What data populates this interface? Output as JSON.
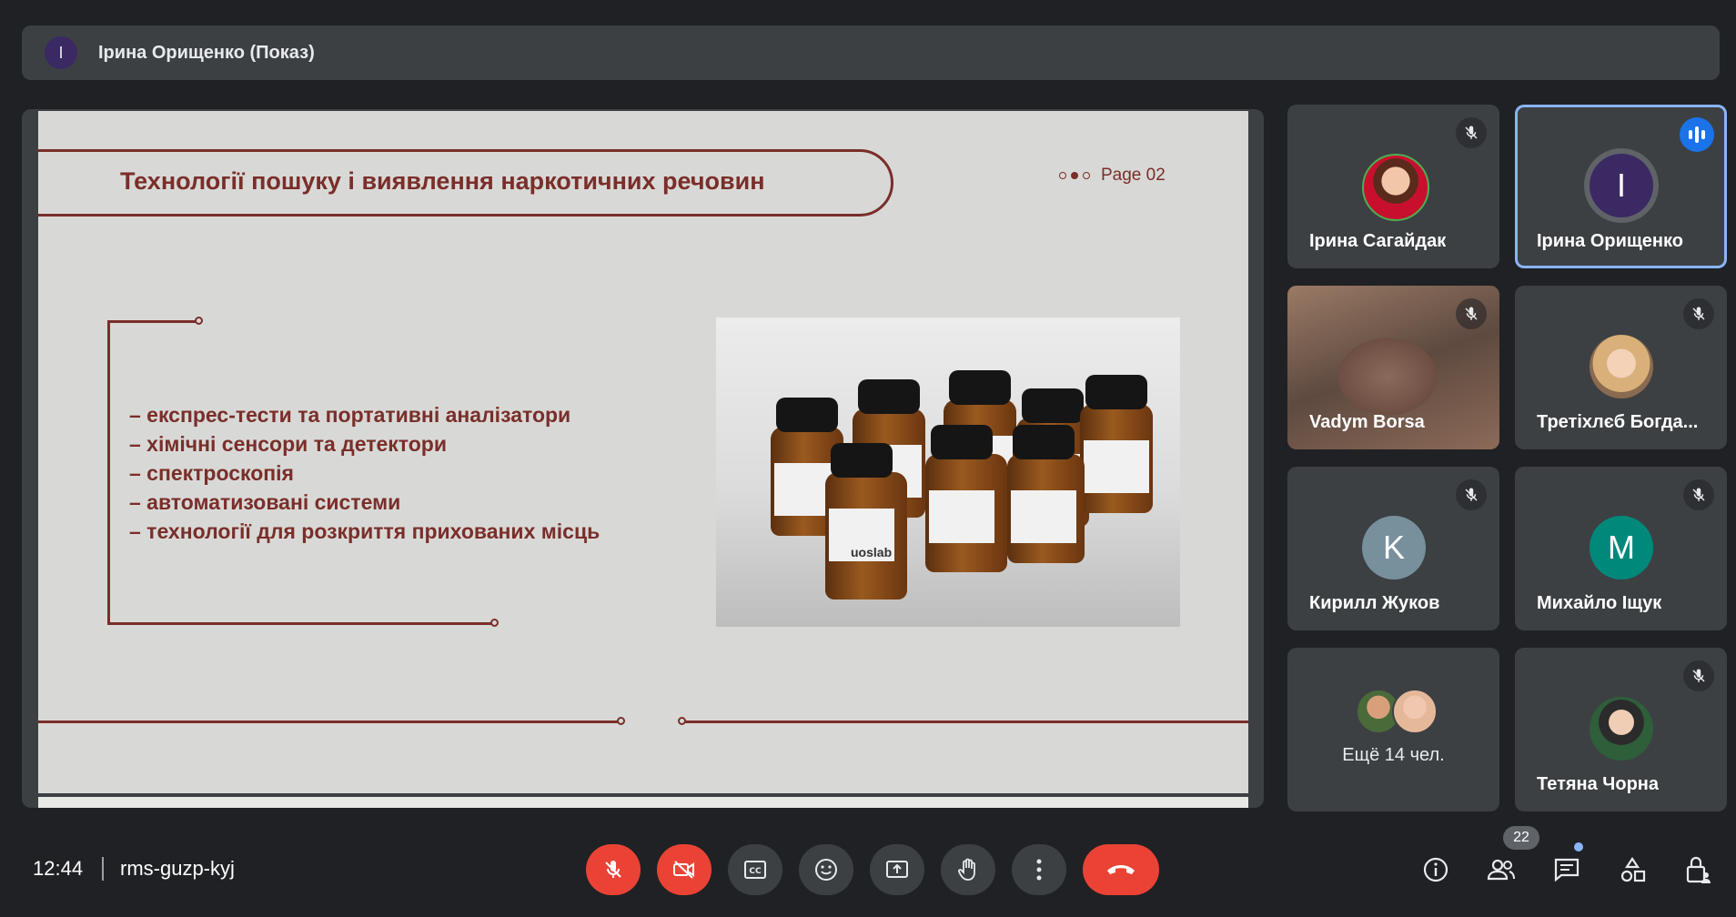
{
  "header": {
    "presenter_initial": "I",
    "presenter_label": "Ірина Орищенко (Показ)"
  },
  "slide": {
    "title": "Технології пошуку і виявлення наркотичних речовин",
    "page_label": "Page 02",
    "bullets": [
      "– експрес-тести та портативні аналізатори",
      "– хімічні сенсори та детектори",
      "– спектроскопія",
      "– автоматизовані системи",
      "– технології для розкриття прихованих місць"
    ],
    "photo_label": "uoslab"
  },
  "participants": [
    {
      "name": "Ірина Сагайдак",
      "muted": true
    },
    {
      "name": "Ірина Орищенко",
      "initial": "I",
      "speaking": true
    },
    {
      "name": "Vadym Borsa",
      "muted": true
    },
    {
      "name": "Третіхлєб Богда...",
      "muted": true
    },
    {
      "name": "Кирилл Жуков",
      "initial": "K",
      "color": "#78909c",
      "muted": true
    },
    {
      "name": "Михайло Іщук",
      "initial": "M",
      "color": "#00897b",
      "muted": true
    },
    {
      "name": "Ещё 14 чел."
    },
    {
      "name": "Тетяна Чорна",
      "muted": true
    }
  ],
  "bottombar": {
    "time": "12:44",
    "meeting_code": "rms-guzp-kyj",
    "people_count": "22"
  },
  "colors": {
    "accent": "#8ab4f8",
    "danger": "#ea4335",
    "slide_text": "#7a2e2a"
  }
}
